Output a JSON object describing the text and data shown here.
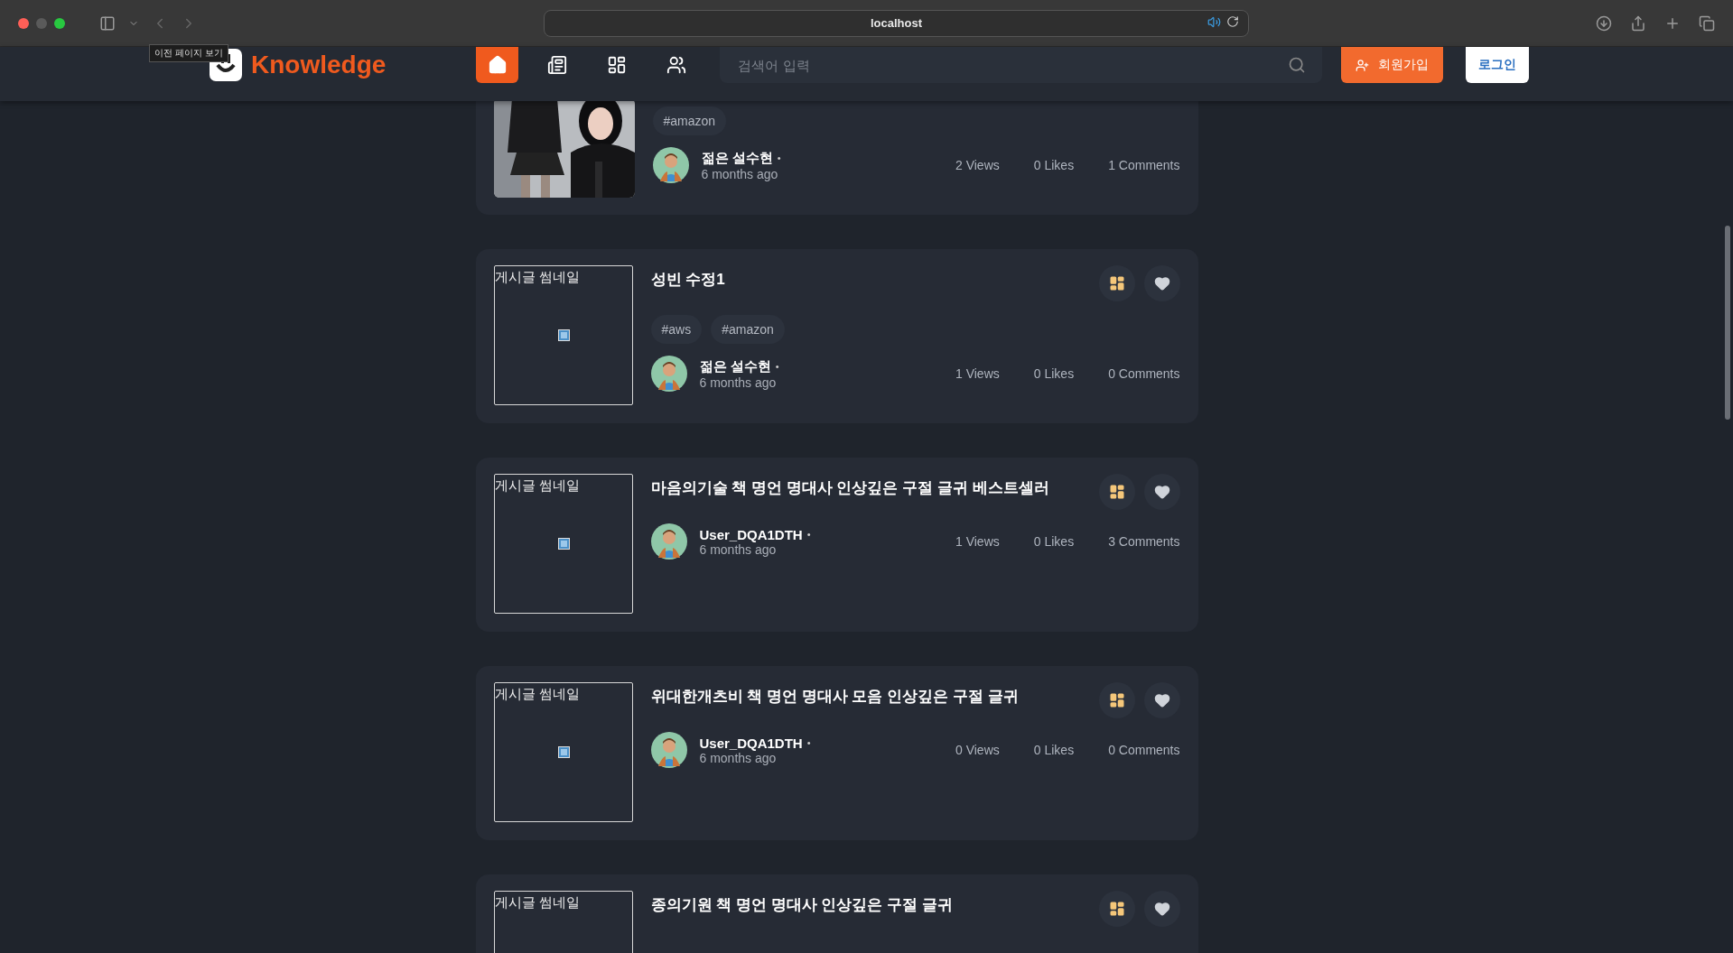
{
  "browser": {
    "url": "localhost",
    "tooltip": "이전 페이지 보기"
  },
  "header": {
    "logo": "Knowledge",
    "nav": [
      {
        "kind": "home",
        "selected": true
      },
      {
        "kind": "posts",
        "selected": false
      },
      {
        "kind": "board",
        "selected": false
      },
      {
        "kind": "people",
        "selected": false
      }
    ],
    "search": {
      "placeholder": "검색어 입력"
    },
    "signup": "회원가입",
    "login": "로그인"
  },
  "posts": [
    {
      "thumbnail": {
        "kind": "picture"
      },
      "tags": [
        "#amazon"
      ],
      "author": "젊은 설수현",
      "dot": "•",
      "time": "6 months ago",
      "views": "2 Views",
      "likes": "0 Likes",
      "comments": "1 Comments"
    },
    {
      "thumbnail": {
        "kind": "broken",
        "alt": "게시글 썸네일"
      },
      "title": "성빈 수정1",
      "tags": [
        "#aws",
        "#amazon"
      ],
      "author": "젊은 설수현",
      "dot": "•",
      "time": "6 months ago",
      "views": "1 Views",
      "likes": "0 Likes",
      "comments": "0 Comments"
    },
    {
      "thumbnail": {
        "kind": "broken",
        "alt": "게시글 썸네일"
      },
      "title": "마음의기술 책 명언 명대사 인상깊은 구절 글귀 베스트셀러",
      "author": "User_DQA1DTH",
      "dot": "•",
      "time": "6 months ago",
      "views": "1 Views",
      "likes": "0 Likes",
      "comments": "3 Comments"
    },
    {
      "thumbnail": {
        "kind": "broken",
        "alt": "게시글 썸네일"
      },
      "title": "위대한개츠비 책 명언 명대사 모음 인상깊은 구절 글귀",
      "author": "User_DQA1DTH",
      "dot": "•",
      "time": "6 months ago",
      "views": "0 Views",
      "likes": "0 Likes",
      "comments": "0 Comments"
    },
    {
      "thumbnail": {
        "kind": "broken",
        "alt": "게시글 썸네일"
      },
      "title": "종의기원 책 명언 명대사 인상깊은 구절 글귀"
    }
  ]
}
